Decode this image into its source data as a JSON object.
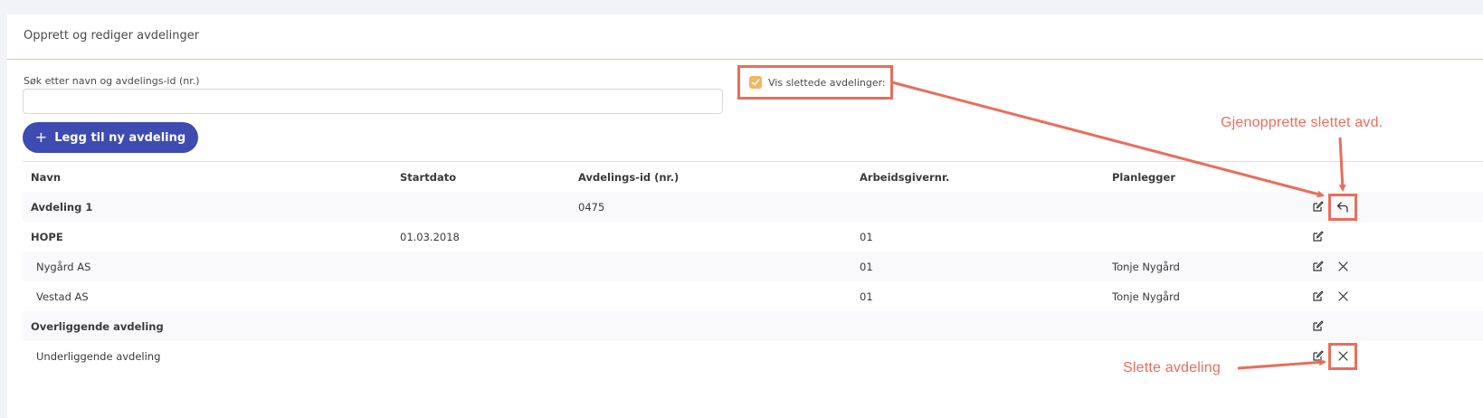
{
  "panel": {
    "title": "Opprett og rediger avdelinger"
  },
  "search": {
    "label": "Søk etter navn og avdelings-id (nr.)",
    "value": "",
    "placeholder": ""
  },
  "show_deleted": {
    "label": "Vis slettede avdelinger:",
    "checked": true
  },
  "add_button": {
    "label": "Legg til ny avdeling"
  },
  "table": {
    "headers": [
      "Navn",
      "Startdato",
      "Avdelings-id (nr.)",
      "Arbeidsgivernr.",
      "Planlegger"
    ],
    "rows": [
      {
        "name": "Avdeling 1",
        "start": "",
        "id": "0475",
        "employer": "",
        "planner": "",
        "style": "bold",
        "actions": [
          "edit",
          "restore"
        ]
      },
      {
        "name": "HOPE",
        "start": "01.03.2018",
        "id": "",
        "employer": "01",
        "planner": "",
        "style": "bold",
        "actions": [
          "edit"
        ]
      },
      {
        "name": "Nygård AS",
        "start": "",
        "id": "",
        "employer": "01",
        "planner": "Tonje Nygård",
        "style": "indent",
        "actions": [
          "edit",
          "delete"
        ]
      },
      {
        "name": "Vestad AS",
        "start": "",
        "id": "",
        "employer": "01",
        "planner": "Tonje Nygård",
        "style": "indent",
        "actions": [
          "edit",
          "delete"
        ]
      },
      {
        "name": "Overliggende avdeling",
        "start": "",
        "id": "",
        "employer": "",
        "planner": "",
        "style": "bold",
        "actions": [
          "edit"
        ]
      },
      {
        "name": "Underliggende avdeling",
        "start": "",
        "id": "",
        "employer": "",
        "planner": "",
        "style": "indent",
        "actions": [
          "edit",
          "delete"
        ]
      }
    ]
  },
  "annotations": {
    "restore": "Gjenopprette slettet avd.",
    "delete": "Slette avdeling"
  },
  "colors": {
    "accent": "#3e4bb0",
    "checkbox": "#f2b65f",
    "annotation": "#ea6d5a",
    "header_border": "#e6c98e"
  }
}
